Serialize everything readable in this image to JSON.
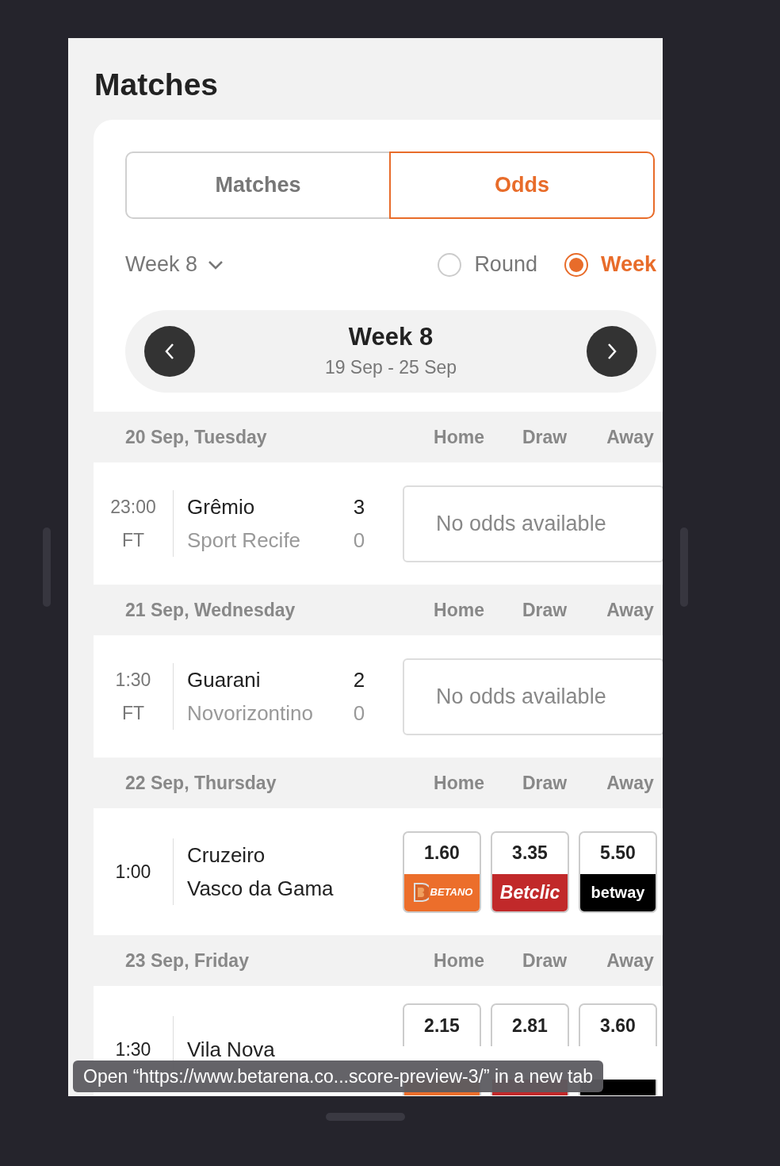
{
  "title": "Matches",
  "tabs": [
    {
      "label": "Matches",
      "selected": false
    },
    {
      "label": "Odds",
      "selected": true
    }
  ],
  "filter": {
    "value": "Week 8",
    "options": [
      {
        "label": "Round",
        "selected": false
      },
      {
        "label": "Week",
        "selected": true
      }
    ]
  },
  "week_nav": {
    "title": "Week 8",
    "range": "19 Sep - 25 Sep"
  },
  "days": [
    {
      "date": "20 Sep, Tuesday",
      "columns": [
        "Home",
        "Draw",
        "Away"
      ],
      "matches": [
        {
          "time": "23:00",
          "status": "FT",
          "home": {
            "name": "Grêmio",
            "score": "3",
            "dimmed": false
          },
          "away": {
            "name": "Sport Recife",
            "score": "0",
            "dimmed": true
          },
          "no_odds": "No odds available"
        }
      ]
    },
    {
      "date": "21 Sep, Wednesday",
      "columns": [
        "Home",
        "Draw",
        "Away"
      ],
      "matches": [
        {
          "time": "1:30",
          "status": "FT",
          "home": {
            "name": "Guarani",
            "score": "2",
            "dimmed": false
          },
          "away": {
            "name": "Novorizontino",
            "score": "0",
            "dimmed": true
          },
          "no_odds": "No odds available"
        }
      ]
    },
    {
      "date": "22 Sep, Thursday",
      "columns": [
        "Home",
        "Draw",
        "Away"
      ],
      "matches": [
        {
          "time": "1:00",
          "home": {
            "name": "Cruzeiro",
            "dimmed": false
          },
          "away": {
            "name": "Vasco da Gama",
            "dimmed": false
          },
          "odds": [
            {
              "value": "1.60",
              "kind": "betano",
              "logo": "BETANO"
            },
            {
              "value": "3.35",
              "kind": "betclic",
              "logo": "Betclic"
            },
            {
              "value": "5.50",
              "kind": "betway",
              "logo": "betway"
            }
          ]
        }
      ]
    },
    {
      "date": "23 Sep, Friday",
      "columns": [
        "Home",
        "Draw",
        "Away"
      ],
      "matches": [
        {
          "time": "1:30",
          "home": {
            "name": "Vila Nova",
            "dimmed": false
          },
          "odds": [
            {
              "value": "2.15",
              "kind": "betano"
            },
            {
              "value": "2.81",
              "kind": "betclic"
            },
            {
              "value": "3.60",
              "kind": "betway"
            }
          ]
        }
      ]
    }
  ],
  "tooltip": "Open “https://www.betarena.co...score-preview-3/” in a new tab"
}
